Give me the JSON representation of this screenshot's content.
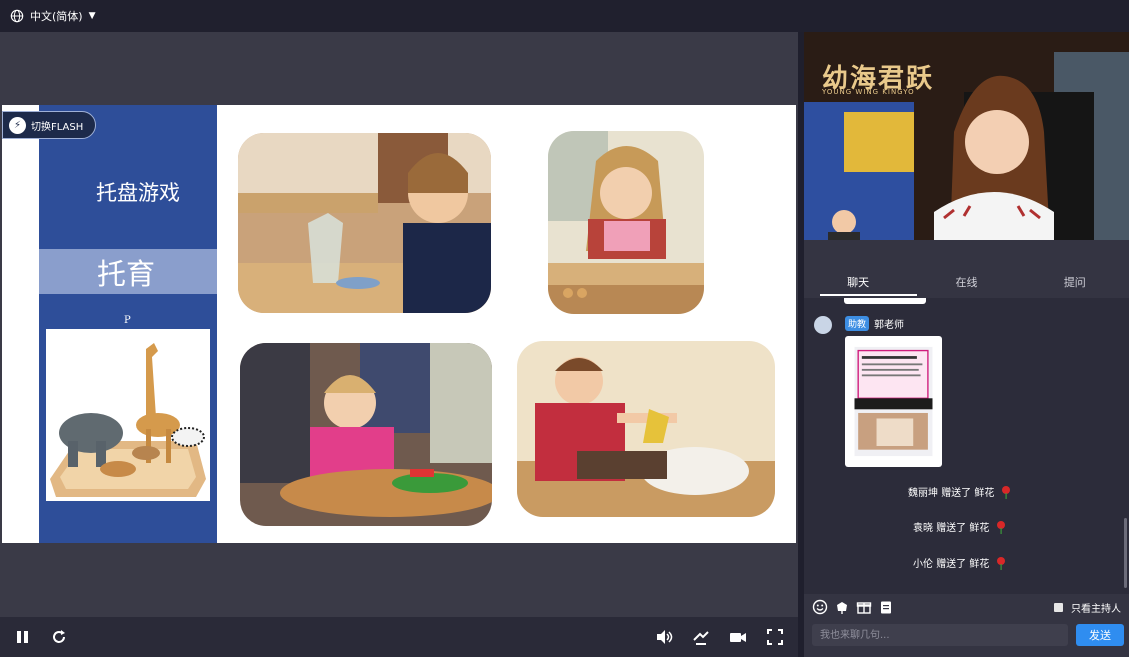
{
  "topbar": {
    "language": "中文(简体)"
  },
  "slide": {
    "flash_button": "切换FLASH",
    "title": "托盘游戏",
    "subtitle": "托育",
    "p_label": "P"
  },
  "video": {
    "logo": "幼海君跃",
    "logo_sub": "YOUNG WING KINGYO"
  },
  "tabs": [
    "聊天",
    "在线",
    "提问"
  ],
  "chat": {
    "badge": "助教",
    "teacher": "郭老师",
    "gifts": [
      {
        "user": "魏丽坤",
        "verb": "赠送了",
        "item": "鲜花"
      },
      {
        "user": "袁晓",
        "verb": "赠送了",
        "item": "鲜花"
      },
      {
        "user": "小伦",
        "verb": "赠送了",
        "item": "鲜花"
      }
    ]
  },
  "toolbar": {
    "host_only": "只看主持人"
  },
  "input": {
    "placeholder": "我也来聊几句...",
    "send": "发送"
  },
  "colors": {
    "slide_blue": "#2e4e99",
    "send_blue": "#2f8df0",
    "badge_blue": "#3d8ee3"
  }
}
